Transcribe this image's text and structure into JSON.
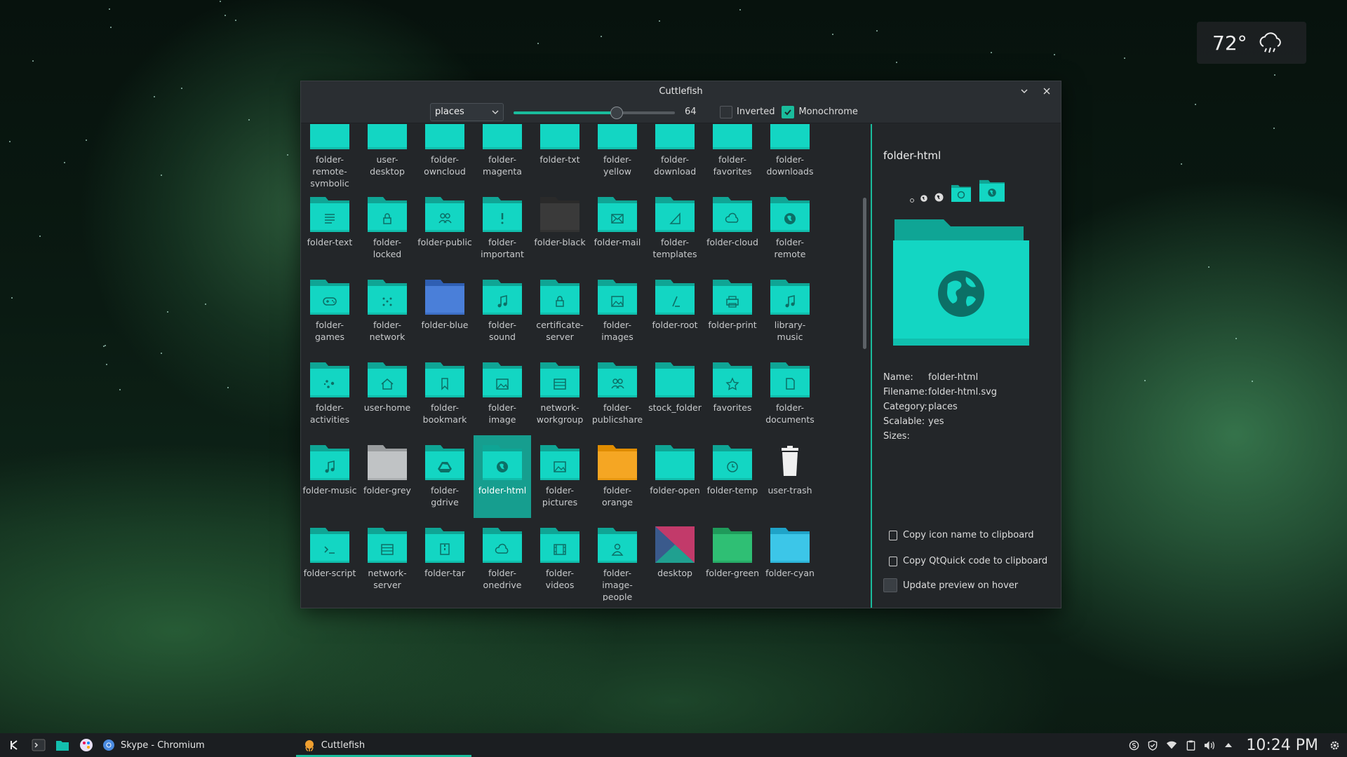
{
  "weather": {
    "temperature": "72°",
    "icon": "rain-cloud-icon"
  },
  "window": {
    "title": "Cuttlefish",
    "toolbar": {
      "category_value": "places",
      "size_value": 64,
      "size_max": 100,
      "inverted_label": "Inverted",
      "inverted_checked": false,
      "monochrome_label": "Monochrome",
      "monochrome_checked": true
    }
  },
  "colors": {
    "accent": "#1abc9c",
    "folder": "#13d6c3",
    "folder_back": "#0fa595",
    "selected": "#169e8f"
  },
  "icons": [
    {
      "label": "folder-\nremote-\nsymbolic",
      "glyph": "",
      "kind": "folder"
    },
    {
      "label": "user-\ndesktop",
      "glyph": "",
      "kind": "folder"
    },
    {
      "label": "folder-\nowncloud",
      "glyph": "",
      "kind": "folder"
    },
    {
      "label": "folder-\nmagenta",
      "glyph": "",
      "kind": "folder"
    },
    {
      "label": "folder-txt",
      "glyph": "",
      "kind": "folder"
    },
    {
      "label": "folder-\nyellow",
      "glyph": "",
      "kind": "folder"
    },
    {
      "label": "folder-\ndownload",
      "glyph": "",
      "kind": "folder"
    },
    {
      "label": "folder-\nfavorites",
      "glyph": "",
      "kind": "folder"
    },
    {
      "label": "folder-\ndownloads",
      "glyph": "",
      "kind": "folder"
    },
    {
      "label": "folder-text",
      "glyph": "text",
      "kind": "folder"
    },
    {
      "label": "folder-\nlocked",
      "glyph": "lock",
      "kind": "folder"
    },
    {
      "label": "folder-public",
      "glyph": "people",
      "kind": "folder"
    },
    {
      "label": "folder-\nimportant",
      "glyph": "!",
      "kind": "folder"
    },
    {
      "label": "folder-black",
      "glyph": "",
      "kind": "black"
    },
    {
      "label": "folder-mail",
      "glyph": "mail",
      "kind": "folder"
    },
    {
      "label": "folder-\ntemplates",
      "glyph": "ruler",
      "kind": "folder"
    },
    {
      "label": "folder-cloud",
      "glyph": "cloud",
      "kind": "folder"
    },
    {
      "label": "folder-\nremote",
      "glyph": "globe",
      "kind": "folder"
    },
    {
      "label": "folder-\ngames",
      "glyph": "gamepad",
      "kind": "folder"
    },
    {
      "label": "folder-\nnetwork",
      "glyph": "network",
      "kind": "folder"
    },
    {
      "label": "folder-blue",
      "glyph": "",
      "kind": "blue"
    },
    {
      "label": "folder-\nsound",
      "glyph": "note",
      "kind": "folder"
    },
    {
      "label": "certificate-\nserver",
      "glyph": "lock",
      "kind": "folder"
    },
    {
      "label": "folder-\nimages",
      "glyph": "image",
      "kind": "folder"
    },
    {
      "label": "folder-root",
      "glyph": "slash",
      "kind": "folder"
    },
    {
      "label": "folder-print",
      "glyph": "print",
      "kind": "folder"
    },
    {
      "label": "library-\nmusic",
      "glyph": "note",
      "kind": "folder"
    },
    {
      "label": "folder-\nactivities",
      "glyph": "activities",
      "kind": "folder"
    },
    {
      "label": "user-home",
      "glyph": "home",
      "kind": "folder"
    },
    {
      "label": "folder-\nbookmark",
      "glyph": "bookmark",
      "kind": "folder"
    },
    {
      "label": "folder-\nimage",
      "glyph": "image",
      "kind": "folder"
    },
    {
      "label": "network-\nworkgroup",
      "glyph": "server",
      "kind": "folder"
    },
    {
      "label": "folder-\npublicshare",
      "glyph": "people",
      "kind": "folder"
    },
    {
      "label": "stock_folder",
      "glyph": "",
      "kind": "folder"
    },
    {
      "label": "favorites",
      "glyph": "star",
      "kind": "folder"
    },
    {
      "label": "folder-\ndocuments",
      "glyph": "doc",
      "kind": "folder"
    },
    {
      "label": "folder-music",
      "glyph": "note",
      "kind": "folder"
    },
    {
      "label": "folder-grey",
      "glyph": "",
      "kind": "grey"
    },
    {
      "label": "folder-\ngdrive",
      "glyph": "drive",
      "kind": "folder"
    },
    {
      "label": "folder-html",
      "glyph": "globe",
      "kind": "folder",
      "selected": true
    },
    {
      "label": "folder-\npictures",
      "glyph": "image",
      "kind": "folder"
    },
    {
      "label": "folder-\norange",
      "glyph": "",
      "kind": "orange"
    },
    {
      "label": "folder-open",
      "glyph": "",
      "kind": "folder"
    },
    {
      "label": "folder-temp",
      "glyph": "clock",
      "kind": "folder"
    },
    {
      "label": "user-trash",
      "glyph": "",
      "kind": "trash"
    },
    {
      "label": "folder-script",
      "glyph": "terminal",
      "kind": "folder"
    },
    {
      "label": "network-\nserver",
      "glyph": "server",
      "kind": "folder"
    },
    {
      "label": "folder-tar",
      "glyph": "zip",
      "kind": "folder"
    },
    {
      "label": "folder-\nonedrive",
      "glyph": "cloud",
      "kind": "folder"
    },
    {
      "label": "folder-\nvideos",
      "glyph": "film",
      "kind": "folder"
    },
    {
      "label": "folder-\nimage-\npeople",
      "glyph": "person",
      "kind": "folder"
    },
    {
      "label": "desktop",
      "glyph": "",
      "kind": "desktop"
    },
    {
      "label": "folder-green",
      "glyph": "",
      "kind": "green"
    },
    {
      "label": "folder-cyan",
      "glyph": "",
      "kind": "cyan"
    },
    {
      "label": "",
      "glyph": "cloud",
      "kind": "folder"
    },
    {
      "label": "",
      "glyph": "film",
      "kind": "folder"
    },
    {
      "label": "",
      "glyph": "",
      "kind": "folder"
    },
    {
      "label": "",
      "glyph": "lock",
      "kind": "folder"
    },
    {
      "label": "",
      "glyph": "",
      "kind": "brown"
    },
    {
      "label": "",
      "glyph": "window",
      "kind": "folder"
    },
    {
      "label": "",
      "glyph": "globe",
      "kind": "folder"
    },
    {
      "label": "",
      "glyph": "",
      "kind": "red"
    },
    {
      "label": "",
      "glyph": "",
      "kind": "trash"
    }
  ],
  "detail": {
    "title": "folder-html",
    "name_key": "Name:",
    "name_val": "folder-html",
    "filename_key": "Filename:",
    "filename_val": "folder-html.svg",
    "category_key": "Category:",
    "category_val": "places",
    "scalable_key": "Scalable:",
    "scalable_val": "yes",
    "sizes_key": "Sizes:",
    "sizes_val": "",
    "copy_name": "Copy icon name to clipboard",
    "copy_qtquick": "Copy QtQuick code to clipboard",
    "update_hover": "Update preview on hover"
  },
  "taskbar": {
    "tasks": [
      {
        "label": "Skype - Chromium",
        "icon": "chromium-icon"
      },
      {
        "label": "Cuttlefish",
        "icon": "cuttlefish-icon"
      }
    ],
    "clock": "10:24 PM"
  }
}
